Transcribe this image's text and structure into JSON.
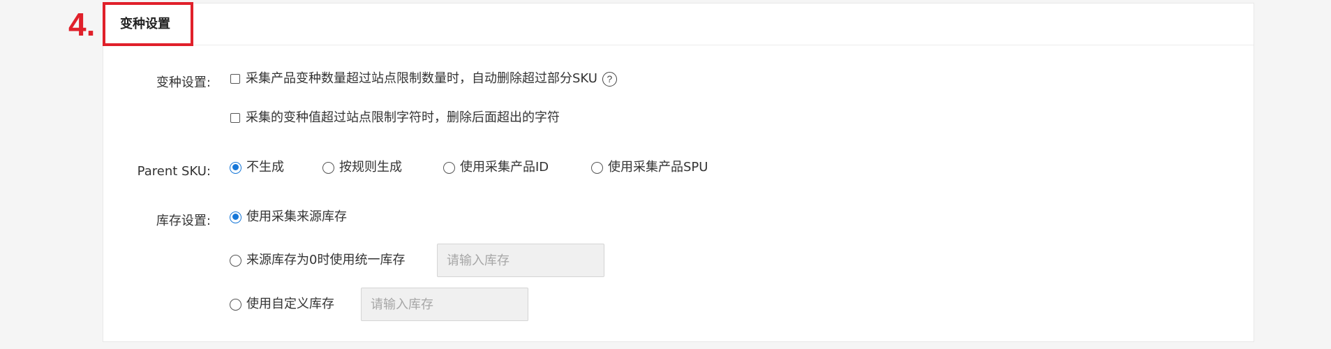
{
  "step": {
    "number": "4."
  },
  "panel": {
    "title": "变种设置"
  },
  "variant_settings": {
    "label": "变种设置:",
    "options": [
      {
        "label": "采集产品变种数量超过站点限制数量时，自动删除超过部分SKU",
        "checked": false,
        "has_help": true,
        "help_glyph": "?"
      },
      {
        "label": "采集的变种值超过站点限制字符时，删除后面超出的字符",
        "checked": false
      }
    ]
  },
  "parent_sku": {
    "label": "Parent SKU:",
    "options": [
      {
        "label": "不生成",
        "selected": true
      },
      {
        "label": "按规则生成",
        "selected": false
      },
      {
        "label": "使用采集产品ID",
        "selected": false
      },
      {
        "label": "使用采集产品SPU",
        "selected": false
      }
    ]
  },
  "stock_settings": {
    "label": "库存设置:",
    "options": [
      {
        "label": "使用采集来源库存",
        "selected": true
      },
      {
        "label": "来源库存为0时使用统一库存",
        "selected": false,
        "input_placeholder": "请输入库存",
        "input_value": ""
      },
      {
        "label": "使用自定义库存",
        "selected": false,
        "input_placeholder": "请输入库存",
        "input_value": ""
      }
    ]
  },
  "colors": {
    "highlight": "#e0202a",
    "radio_selected": "#1677d8",
    "input_background": "#f0f0f0",
    "page_background": "#f5f5f5"
  },
  "icons": {
    "help": "question-circle-icon"
  }
}
